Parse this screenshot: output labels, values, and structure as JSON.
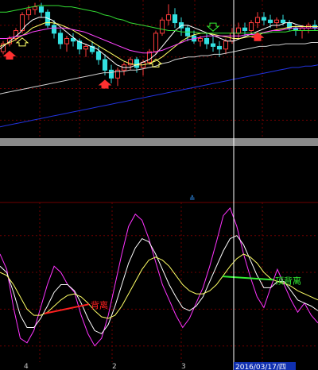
{
  "colors": {
    "background": "#000000",
    "grid": "#6e0000",
    "up_candle": "#ff3b3b",
    "down_candle": "#33e0e0",
    "ma_fast": "#ffffff",
    "ma_mid": "#ffff66",
    "ma_slow": "#ff44ff",
    "ma_long": "#33dd33",
    "ma_longer": "#cfcfcf",
    "ma_longest": "#2233dd",
    "osc_fast": "#ff33ff",
    "osc_mid": "#ffffff",
    "osc_slow": "#ffff66",
    "bottom_divergence_line": "#ff2020",
    "top_divergence_line": "#33ee33",
    "cursor": "#ffffff",
    "separator": "#909090",
    "date_box": "#1030b0"
  },
  "chart_data": [
    {
      "type": "candlestick",
      "name": "price-panel",
      "ylim": [
        0,
        100
      ],
      "candles": [
        [
          62,
          70,
          60,
          68
        ],
        [
          68,
          74,
          66,
          72
        ],
        [
          72,
          80,
          70,
          78
        ],
        [
          78,
          92,
          76,
          90
        ],
        [
          90,
          97,
          86,
          94
        ],
        [
          94,
          99,
          90,
          96
        ],
        [
          96,
          99,
          88,
          92
        ],
        [
          92,
          94,
          80,
          82
        ],
        [
          82,
          86,
          72,
          76
        ],
        [
          76,
          79,
          64,
          68
        ],
        [
          68,
          74,
          62,
          72
        ],
        [
          72,
          76,
          66,
          70
        ],
        [
          70,
          72,
          60,
          64
        ],
        [
          64,
          68,
          58,
          66
        ],
        [
          66,
          70,
          60,
          62
        ],
        [
          62,
          66,
          52,
          56
        ],
        [
          56,
          60,
          44,
          48
        ],
        [
          48,
          52,
          38,
          42
        ],
        [
          42,
          50,
          36,
          48
        ],
        [
          48,
          54,
          44,
          52
        ],
        [
          52,
          58,
          48,
          56
        ],
        [
          56,
          58,
          46,
          50
        ],
        [
          50,
          56,
          44,
          54
        ],
        [
          54,
          64,
          52,
          62
        ],
        [
          62,
          78,
          60,
          76
        ],
        [
          76,
          88,
          74,
          86
        ],
        [
          86,
          98,
          82,
          90
        ],
        [
          90,
          95,
          80,
          84
        ],
        [
          84,
          88,
          74,
          80
        ],
        [
          80,
          82,
          70,
          74
        ],
        [
          74,
          78,
          68,
          70
        ],
        [
          70,
          74,
          66,
          72
        ],
        [
          72,
          76,
          64,
          68
        ],
        [
          68,
          74,
          62,
          66
        ],
        [
          66,
          70,
          58,
          64
        ],
        [
          64,
          72,
          60,
          70
        ],
        [
          70,
          80,
          68,
          76
        ],
        [
          76,
          84,
          72,
          80
        ],
        [
          80,
          84,
          74,
          78
        ],
        [
          78,
          86,
          76,
          84
        ],
        [
          84,
          92,
          80,
          88
        ],
        [
          88,
          92,
          82,
          86
        ],
        [
          86,
          90,
          80,
          84
        ],
        [
          84,
          88,
          80,
          86
        ],
        [
          86,
          90,
          82,
          84
        ],
        [
          84,
          86,
          78,
          80
        ],
        [
          80,
          82,
          74,
          78
        ],
        [
          78,
          82,
          72,
          80
        ],
        [
          80,
          84,
          76,
          82
        ],
        [
          82,
          86,
          78,
          80
        ]
      ],
      "moving_averages": [
        {
          "color_key": "ma_fast",
          "values": [
            64,
            68,
            72,
            76,
            82,
            86,
            88,
            88,
            86,
            82,
            78,
            74,
            70,
            68,
            66,
            64,
            60,
            56,
            52,
            50,
            50,
            52,
            54,
            56,
            60,
            66,
            72,
            78,
            82,
            82,
            80,
            78,
            76,
            74,
            72,
            70,
            70,
            72,
            74,
            76,
            78,
            80,
            82,
            82,
            84,
            84,
            82,
            81,
            81,
            81
          ]
        },
        {
          "color_key": "ma_mid",
          "values": [
            66,
            68,
            70,
            73,
            76,
            80,
            82,
            84,
            84,
            83,
            81,
            79,
            76,
            73,
            70,
            67,
            64,
            61,
            58,
            55,
            53,
            52,
            52,
            53,
            55,
            58,
            62,
            66,
            70,
            73,
            75,
            76,
            76,
            75,
            74,
            73,
            72,
            72,
            73,
            74,
            75,
            77,
            78,
            79,
            80,
            81,
            81,
            81,
            81,
            81
          ]
        },
        {
          "color_key": "ma_slow",
          "values": [
            72,
            72,
            73,
            74,
            75,
            77,
            78,
            79,
            80,
            80,
            80,
            79,
            78,
            77,
            75,
            73,
            71,
            69,
            67,
            65,
            63,
            62,
            61,
            61,
            62,
            63,
            65,
            67,
            69,
            71,
            72,
            73,
            74,
            74,
            74,
            74,
            74,
            74,
            75,
            75,
            76,
            77,
            78,
            78,
            79,
            80,
            80,
            80,
            80,
            80
          ]
        },
        {
          "color_key": "ma_long",
          "values": [
            92,
            92,
            93,
            94,
            95,
            96,
            97,
            97,
            97,
            97,
            96,
            96,
            95,
            94,
            93,
            92,
            90,
            89,
            87,
            86,
            84,
            83,
            82,
            81,
            80,
            79,
            78,
            78,
            77,
            77,
            77,
            76,
            76,
            76,
            76,
            76,
            76,
            76,
            76,
            76,
            76,
            76,
            77,
            77,
            77,
            78,
            78,
            78,
            78,
            78
          ]
        },
        {
          "color_key": "ma_longer",
          "values": [
            30,
            31,
            32,
            33,
            34,
            35,
            36,
            37,
            38,
            39,
            40,
            41,
            42,
            43,
            44,
            45,
            46,
            46,
            47,
            47,
            48,
            48,
            49,
            50,
            51,
            53,
            54,
            56,
            57,
            58,
            58,
            59,
            59,
            60,
            60,
            61,
            62,
            63,
            64,
            65,
            66,
            66,
            67,
            67,
            68,
            68,
            68,
            68,
            69,
            69
          ]
        },
        {
          "color_key": "ma_longest",
          "values": [
            5,
            6,
            7,
            8,
            9,
            10,
            11,
            12,
            13,
            14,
            15,
            16,
            17,
            18,
            19,
            20,
            21,
            22,
            23,
            24,
            25,
            26,
            27,
            28,
            29,
            30,
            31,
            32,
            33,
            34,
            35,
            36,
            37,
            38,
            39,
            40,
            41,
            42,
            43,
            44,
            45,
            46,
            47,
            48,
            49,
            50,
            50,
            51,
            51,
            52
          ]
        }
      ],
      "markers": [
        {
          "index": 1,
          "type": "up-arrow",
          "color": "#ff3030"
        },
        {
          "index": 3,
          "type": "hollow-up-arrow",
          "color": "#ffff66"
        },
        {
          "index": 16,
          "type": "up-arrow",
          "color": "#ff3030"
        },
        {
          "index": 24,
          "type": "hollow-up-arrow",
          "color": "#ffff66"
        },
        {
          "index": 33,
          "type": "hollow-down-arrow",
          "color": "#33ee33"
        },
        {
          "index": 40,
          "type": "up-arrow",
          "color": "#ff3030"
        }
      ]
    },
    {
      "type": "line",
      "name": "oscillator-panel",
      "ylim": [
        0,
        100
      ],
      "series": [
        {
          "color_key": "osc_fast",
          "values": [
            70,
            60,
            35,
            15,
            12,
            20,
            35,
            50,
            62,
            58,
            50,
            45,
            30,
            18,
            10,
            15,
            30,
            50,
            70,
            88,
            96,
            92,
            80,
            65,
            50,
            40,
            30,
            22,
            28,
            38,
            48,
            62,
            78,
            95,
            100,
            88,
            70,
            55,
            42,
            35,
            48,
            60,
            50,
            40,
            32,
            38,
            30,
            25
          ]
        },
        {
          "color_key": "osc_mid",
          "values": [
            62,
            58,
            45,
            30,
            22,
            22,
            28,
            36,
            45,
            50,
            50,
            46,
            38,
            28,
            20,
            18,
            24,
            36,
            50,
            64,
            74,
            80,
            78,
            70,
            60,
            50,
            42,
            35,
            33,
            36,
            42,
            52,
            62,
            72,
            80,
            82,
            76,
            66,
            56,
            48,
            48,
            52,
            52,
            46,
            40,
            38,
            36,
            33
          ]
        },
        {
          "color_key": "osc_slow",
          "values": [
            58,
            56,
            50,
            42,
            34,
            30,
            30,
            32,
            36,
            40,
            43,
            44,
            42,
            38,
            33,
            29,
            28,
            30,
            36,
            44,
            52,
            60,
            66,
            68,
            66,
            62,
            56,
            50,
            46,
            44,
            44,
            46,
            50,
            56,
            62,
            67,
            70,
            68,
            64,
            58,
            54,
            52,
            51,
            49,
            46,
            44,
            42,
            40
          ]
        }
      ],
      "annotations": [
        {
          "label": "背离",
          "line_color_key": "bottom_divergence_line",
          "from_index": 14,
          "to_index": 28
        },
        {
          "label": "顶背离",
          "line_color_key": "top_divergence_line",
          "from_index": 70,
          "to_index": 86
        }
      ]
    }
  ],
  "axis_labels": [
    "4",
    "2",
    "3"
  ],
  "cursor_date": "2016/03/17/四",
  "indicator_marker": "≙"
}
